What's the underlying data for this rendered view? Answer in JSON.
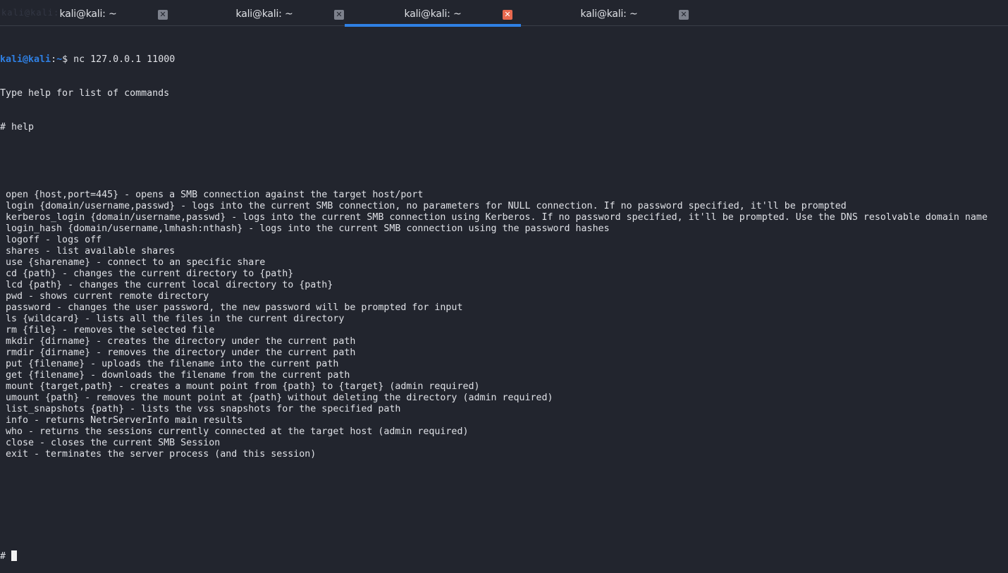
{
  "window": {
    "ghost_title": "kali@kali: ~"
  },
  "tabs": [
    {
      "label": "kali@kali: ~",
      "active": false
    },
    {
      "label": "kali@kali: ~",
      "active": false
    },
    {
      "label": "kali@kali: ~",
      "active": true
    },
    {
      "label": "kali@kali: ~",
      "active": false
    }
  ],
  "terminal": {
    "prompt": {
      "user_host": "kali@kali",
      "separator": ":",
      "path": "~",
      "symbol": "$ ",
      "command": "nc 127.0.0.1 11000"
    },
    "intro": "Type help for list of commands",
    "help_cmd": "# help",
    "help_lines": [
      " open {host,port=445} - opens a SMB connection against the target host/port",
      " login {domain/username,passwd} - logs into the current SMB connection, no parameters for NULL connection. If no password specified, it'll be prompted",
      " kerberos_login {domain/username,passwd} - logs into the current SMB connection using Kerberos. If no password specified, it'll be prompted. Use the DNS resolvable domain name",
      " login_hash {domain/username,lmhash:nthash} - logs into the current SMB connection using the password hashes",
      " logoff - logs off",
      " shares - list available shares",
      " use {sharename} - connect to an specific share",
      " cd {path} - changes the current directory to {path}",
      " lcd {path} - changes the current local directory to {path}",
      " pwd - shows current remote directory",
      " password - changes the user password, the new password will be prompted for input",
      " ls {wildcard} - lists all the files in the current directory",
      " rm {file} - removes the selected file",
      " mkdir {dirname} - creates the directory under the current path",
      " rmdir {dirname} - removes the directory under the current path",
      " put {filename} - uploads the filename into the current path",
      " get {filename} - downloads the filename from the current path",
      " mount {target,path} - creates a mount point from {path} to {target} (admin required)",
      " umount {path} - removes the mount point at {path} without deleting the directory (admin required)",
      " list_snapshots {path} - lists the vss snapshots for the specified path",
      " info - returns NetrServerInfo main results",
      " who - returns the sessions currently connected at the target host (admin required)",
      " close - closes the current SMB Session",
      " exit - terminates the server process (and this session)"
    ],
    "final_prompt": "# "
  },
  "colors": {
    "background": "#22252e",
    "text": "#dfe1e6",
    "accent": "#2f80e4",
    "active_close": "#e8694f"
  },
  "icons": {
    "tab_close": "close-icon"
  }
}
